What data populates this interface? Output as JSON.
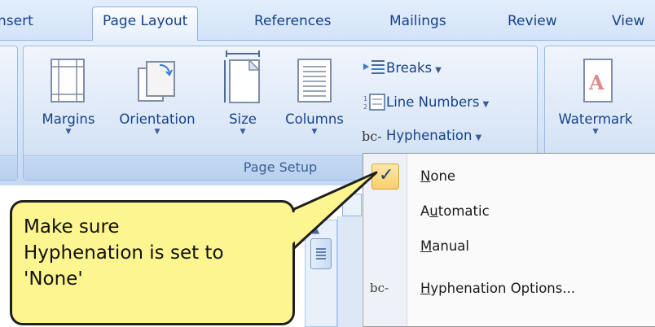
{
  "tabs": [
    "Insert",
    "Page Layout",
    "References",
    "Mailings",
    "Review",
    "View"
  ],
  "active_tab": "Page Layout",
  "ribbon": {
    "page_setup": {
      "label": "Page Setup",
      "buttons": [
        {
          "label": "Margins",
          "icon": "margins-icon"
        },
        {
          "label": "Orientation",
          "icon": "orientation-icon"
        },
        {
          "label": "Size",
          "icon": "size-icon"
        },
        {
          "label": "Columns",
          "icon": "columns-icon"
        }
      ],
      "small_buttons": [
        {
          "label": "Breaks",
          "icon": "breaks-icon"
        },
        {
          "label": "Line Numbers",
          "icon": "line-numbers-icon"
        },
        {
          "label": "Hyphenation",
          "icon": "hyphenation-icon",
          "glyph": "bc‑"
        }
      ]
    },
    "page_background": {
      "buttons": [
        {
          "label": "Watermark",
          "icon": "watermark-icon"
        }
      ]
    }
  },
  "hyphenation_menu": {
    "items": [
      {
        "label": "None",
        "underline_index": 0,
        "checked": true
      },
      {
        "label": "Automatic",
        "underline_index": 1,
        "checked": false
      },
      {
        "label": "Manual",
        "underline_index": 0,
        "checked": false
      },
      {
        "label": "Hyphenation Options...",
        "underline_index": 0,
        "checked": false,
        "icon": "hyphenation-icon"
      }
    ]
  },
  "callout": {
    "text": "Make sure\nHyphenation is set to\n'None'"
  },
  "colors": {
    "ribbon_text": "#15428b",
    "callout_fill": "#fdf58f",
    "check_highlight": "#f9cf6a"
  }
}
